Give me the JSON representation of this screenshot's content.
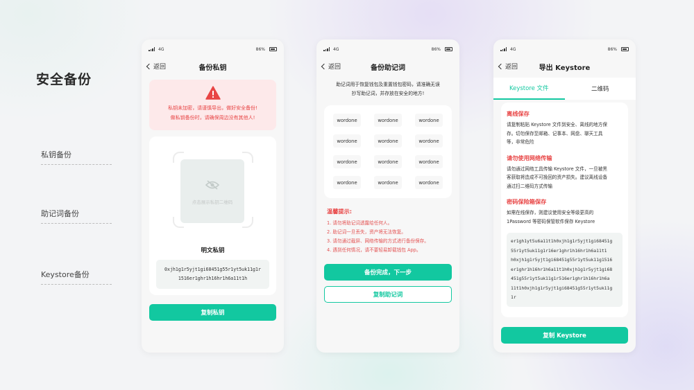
{
  "page": {
    "title": "安全备份"
  },
  "side_labels": [
    "私钥备份",
    "助记词备份",
    "Keystore备份"
  ],
  "status_bar": {
    "network": "4G",
    "battery": "86%"
  },
  "back_label": "返回",
  "phone1": {
    "title": "备份私钥",
    "warning_line1": "私钥未加密，请谨慎导出，做好安全备份!",
    "warning_line2": "做私钥备份时，请确保周边没有其他人!",
    "qr_hint": "点击展示私钥二维码",
    "plain_title": "明文私钥",
    "key_line1": "0xjh1g1r5yjt1gi68451g55r1yt5uk11g1r",
    "key_line2": "1516er1ghr1h16hr1h6a11t1h",
    "copy_button": "复制私钥"
  },
  "phone2": {
    "title": "备份助记词",
    "intro_line1": "助记词用于恢复钱包及重置钱包密码，请准确无误",
    "intro_line2": "抄写助记词，并存放在安全的地方!",
    "words": [
      "wordone",
      "wordone",
      "wordone",
      "wordone",
      "wordone",
      "wordone",
      "wordone",
      "wordone",
      "wordone",
      "wordone",
      "wordone",
      "wordone"
    ],
    "tips_title": "温馨提示:",
    "tips": [
      "1. 请勿将助记词透露给任何人。",
      "2. 助记词一旦丢失，资产将无法恢复。",
      "3. 请勿通过截屏、网络传输的方式进行备份保存。",
      "4. 遇到任何情况，请不要轻易卸载钱包 App。"
    ],
    "done_button": "备份完成，下一步",
    "copy_button": "复制助记词"
  },
  "phone3": {
    "title": "导出 Keystore",
    "tabs": [
      "Keystore 文件",
      "二维码"
    ],
    "sections": [
      {
        "title": "离线保存",
        "lines": [
          "请复制粘贴 Keystore 文件到安全、离线的地方保",
          "存。切勿保存至邮箱、记事本、网盘、聊天工具",
          "等，非常危险"
        ]
      },
      {
        "title": "请勿使用网络传输",
        "lines": [
          "请勿通过网络工具传输 Keystore 文件，一旦被黑",
          "客获取将造成不可挽回的资产损失。建议离线设备",
          "通过扫二维码方式传输"
        ]
      },
      {
        "title": "密码保险箱保存",
        "lines": [
          "如需在线保存，则建议使用安全等级更高的",
          "1Password 等密码保管软件保存 Keystore"
        ]
      }
    ],
    "keystore_lines": [
      "er1gh1yt5u6a11t1h0xjh1g1r5yjt1gi68451g",
      "55r1yt5uk11g1r16er1ghr1h16hr1h6a11t1",
      "h0xjh1g1r5yjt1gi68451g55r1yt5uk11g1516",
      "er1ghr1h16hr1h6a11t1h0xjh1g1r5yjt1gi68",
      "451g55r1yt5uk11g1r516er1ghr1h16hr1h6a",
      "11t1h0xjh1g1r5yjt1gi68451g55r1yt5uk11g",
      "1r"
    ],
    "copy_button": "复制 Keystore"
  },
  "colors": {
    "accent": "#12c8a0",
    "danger": "#e84545",
    "warning_bg": "#fde9ea"
  }
}
